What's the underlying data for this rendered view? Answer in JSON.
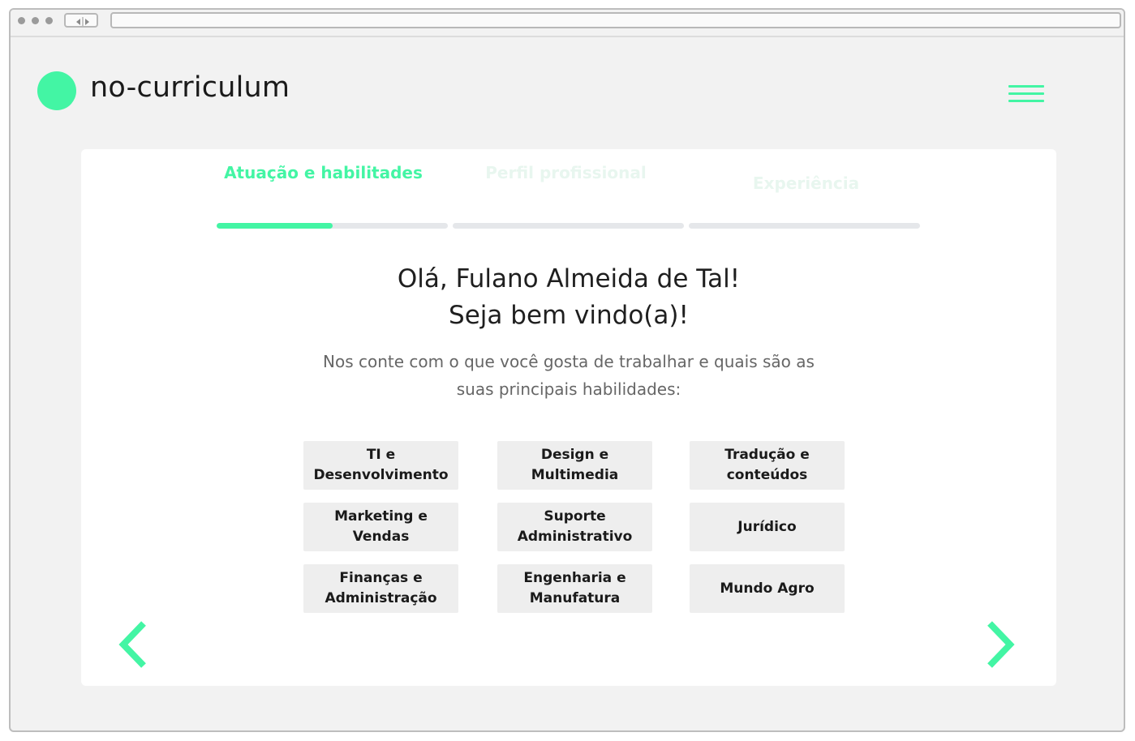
{
  "app": {
    "name": "no-curriculum",
    "accent": "#43f5a4"
  },
  "steps": [
    {
      "label": "Atuação e habilitades",
      "state": "active",
      "progress": 0.5
    },
    {
      "label": "Perfil profissional",
      "state": "inactive",
      "progress": 0
    },
    {
      "label": "Experiência",
      "state": "inactive",
      "progress": 0
    }
  ],
  "greeting": {
    "line1": "Olá, Fulano Almeida de Tal!",
    "line2": "Seja bem vindo(a)!"
  },
  "subtitle": "Nos conte com o que você gosta de trabalhar e quais são as suas principais habilidades:",
  "categories": [
    "TI e Desenvolvimento",
    "Design e Multimedia",
    "Tradução e conteúdos",
    "Marketing e Vendas",
    "Suporte Administrativo",
    "Jurídico",
    "Finanças e Administração",
    "Engenharia e Manufatura",
    "Mundo Agro"
  ],
  "icons": {
    "logo": "circle-logo-icon",
    "menu": "hamburger-menu-icon",
    "prev": "chevron-left-icon",
    "next": "chevron-right-icon"
  }
}
